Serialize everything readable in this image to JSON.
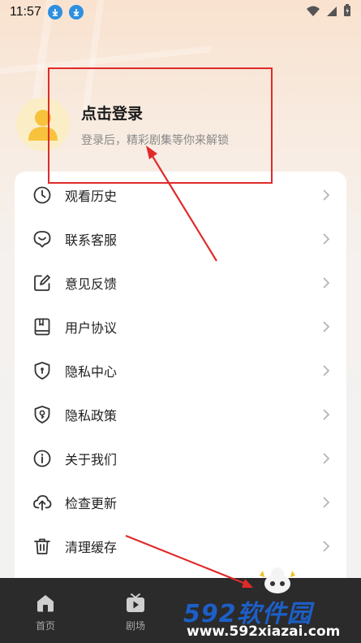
{
  "status_bar": {
    "time": "11:57"
  },
  "profile": {
    "title": "点击登录",
    "subtitle": "登录后，精彩剧集等你来解锁"
  },
  "menu": {
    "items": [
      {
        "label": "观看历史",
        "icon": "clock-icon"
      },
      {
        "label": "联系客服",
        "icon": "chat-bubble-icon"
      },
      {
        "label": "意见反馈",
        "icon": "edit-icon"
      },
      {
        "label": "用户协议",
        "icon": "book-icon"
      },
      {
        "label": "隐私中心",
        "icon": "shield-lock-icon"
      },
      {
        "label": "隐私政策",
        "icon": "shield-key-icon"
      },
      {
        "label": "关于我们",
        "icon": "info-icon"
      },
      {
        "label": "检查更新",
        "icon": "cloud-upload-icon"
      },
      {
        "label": "清理缓存",
        "icon": "trash-icon"
      }
    ]
  },
  "tabs": [
    {
      "label": "首页",
      "icon": "home-icon"
    },
    {
      "label": "剧场",
      "icon": "tv-icon"
    }
  ],
  "watermark": {
    "brand": "592软件园",
    "url": "www.592xiazai.com"
  },
  "colors": {
    "accent_red": "#e02a2a",
    "tab_bar": "#2b2b2b",
    "avatar_bg": "#fbeec6",
    "avatar_fg": "#f7c23c"
  }
}
